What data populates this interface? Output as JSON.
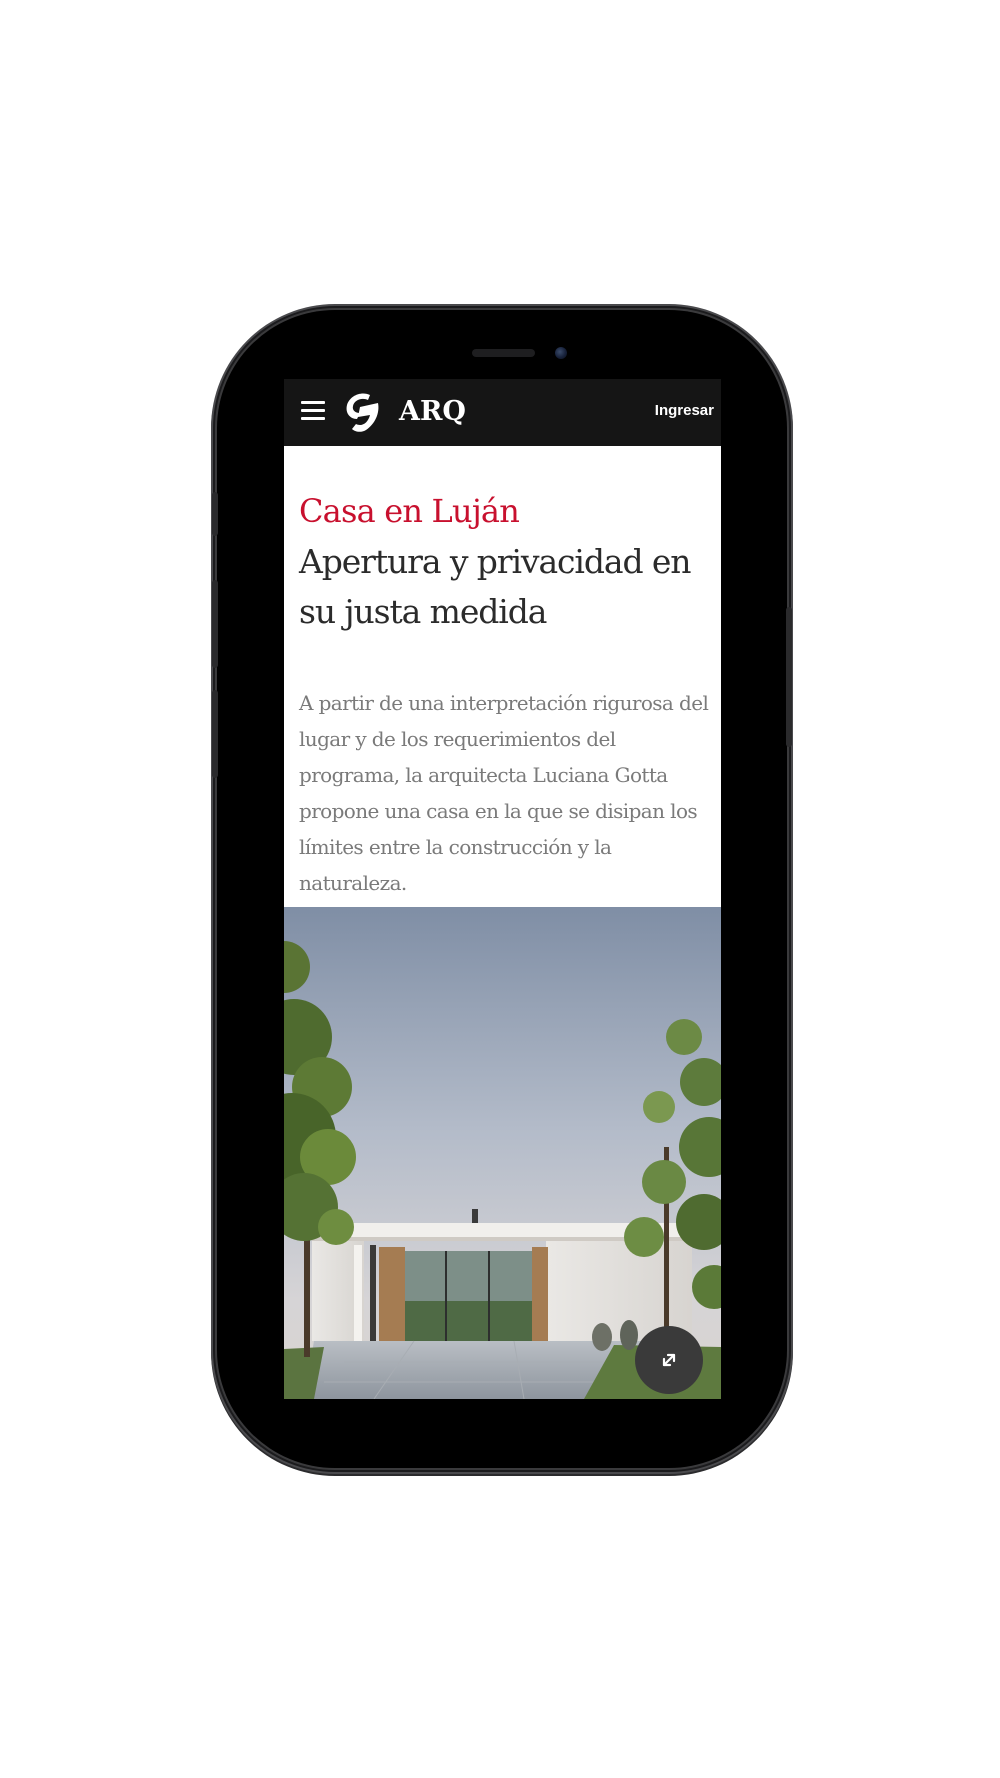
{
  "header": {
    "menu_icon": "hamburger-menu-icon",
    "logo_icon": "arq-logo-icon",
    "brand": "ARQ",
    "login_label": "Ingresar"
  },
  "article": {
    "kicker": "Casa en Luján",
    "headline": "Apertura y privacidad en su justa medida",
    "summary": "A partir de una interpretación rigurosa del lugar y de los requerimientos del programa, la arquitecta Luciana Gotta propone una casa en la que se disipan los límites entre la construcción y la naturaleza."
  },
  "media": {
    "expand_icon": "expand-arrows-icon"
  },
  "colors": {
    "accent": "#c8102e",
    "topbar": "#151515",
    "headline": "#2b2b2b",
    "summary": "#7a7a7a"
  }
}
